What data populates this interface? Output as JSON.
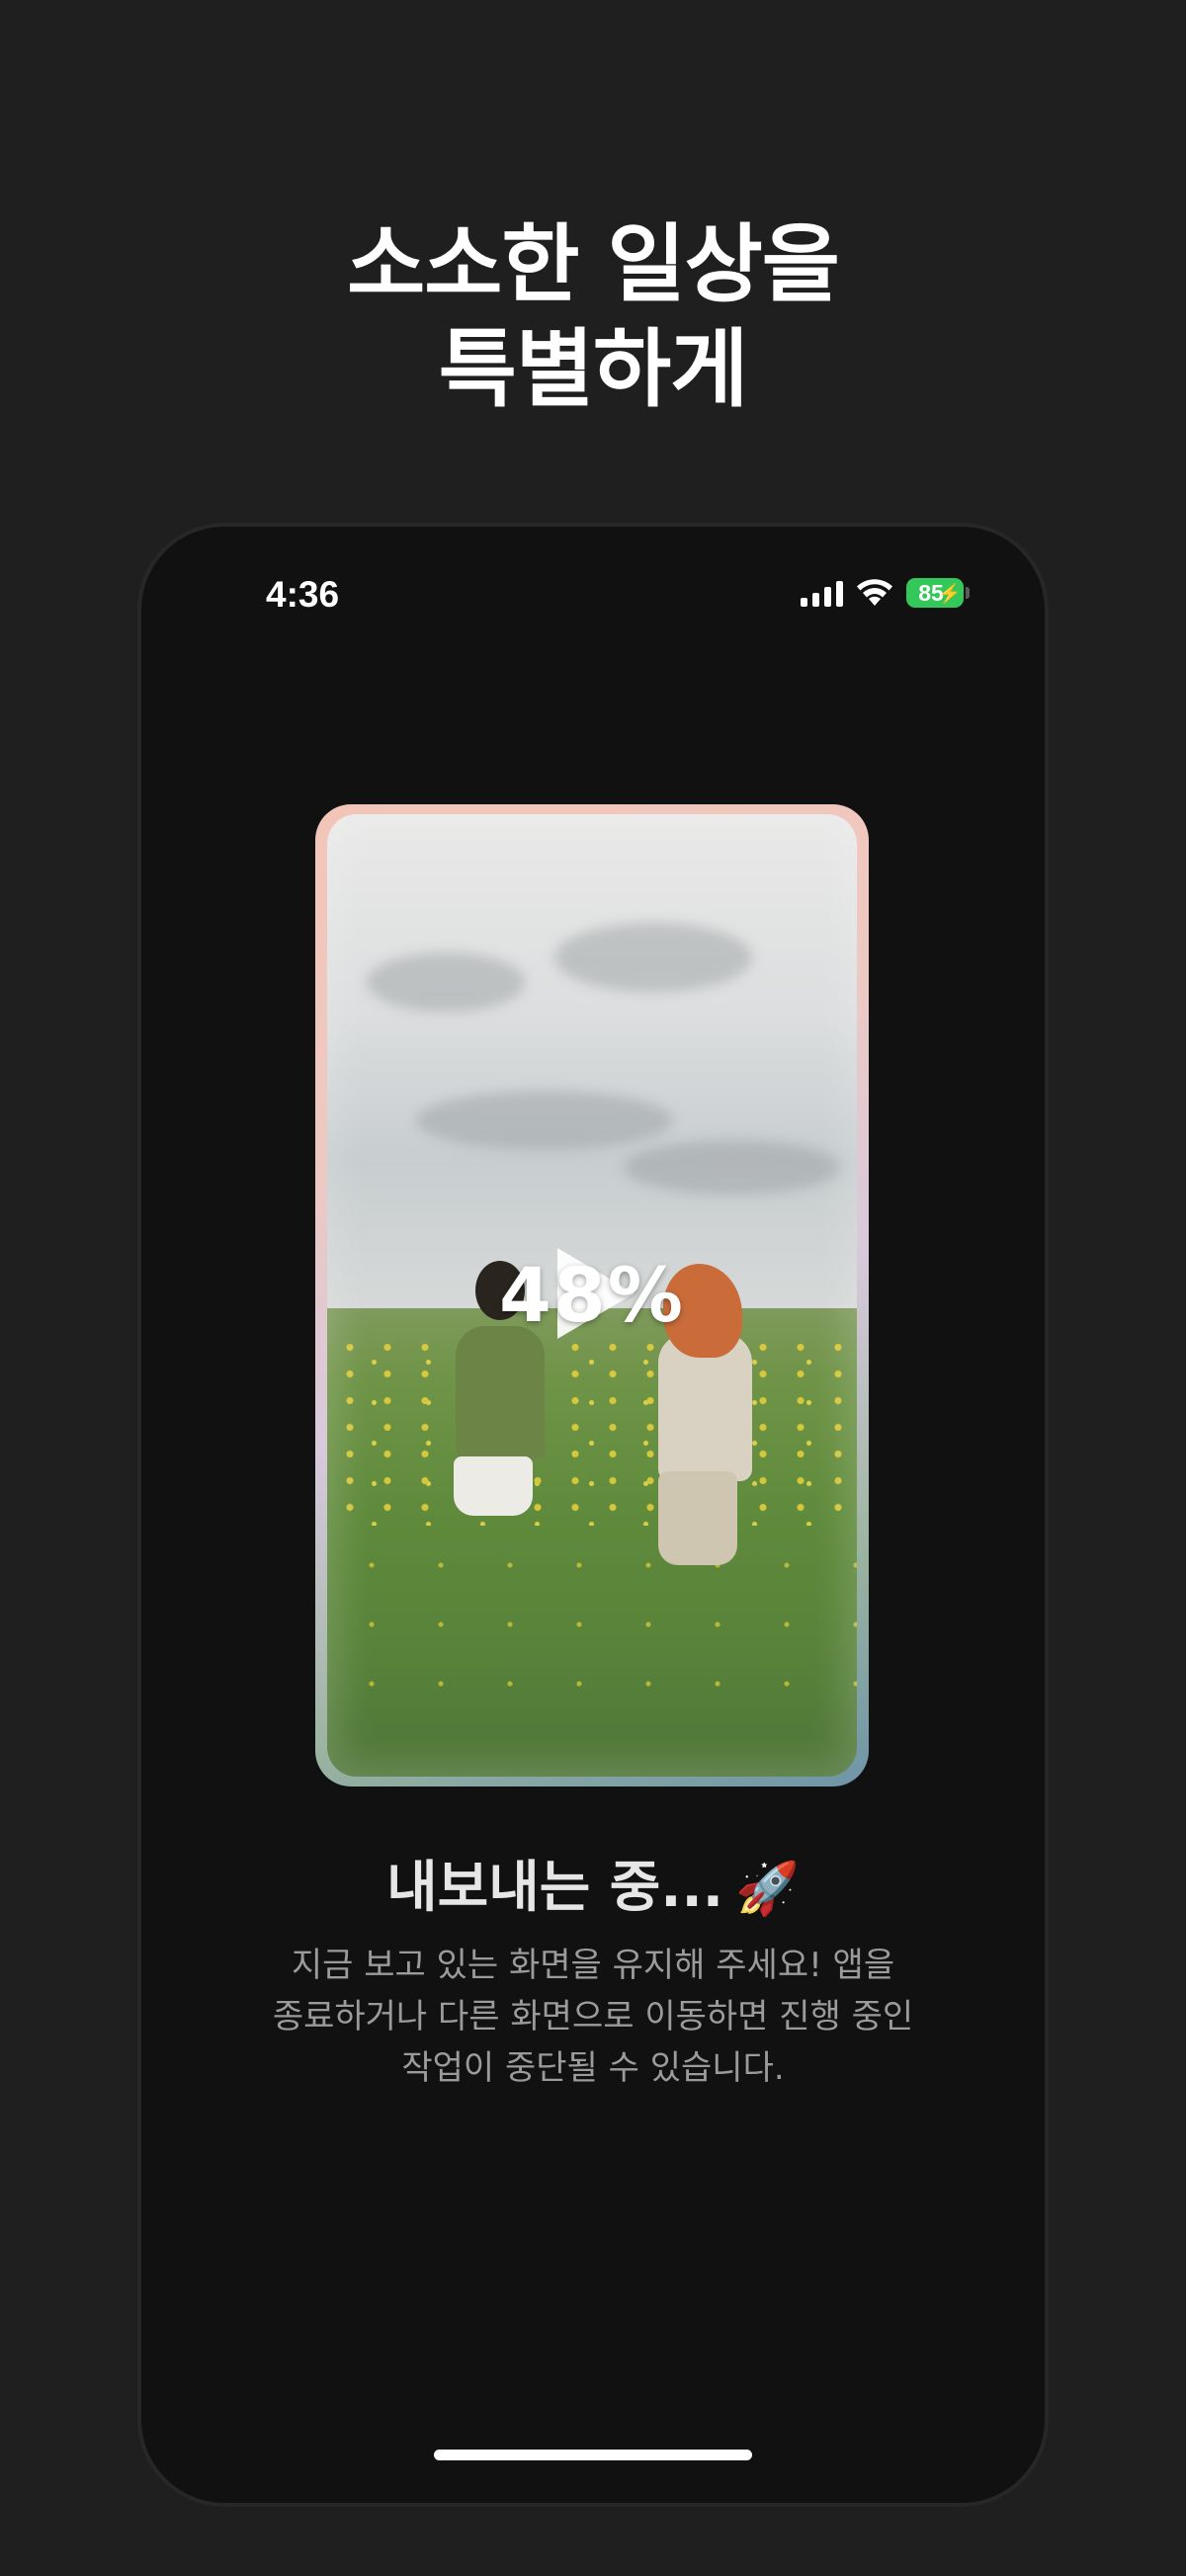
{
  "headline": {
    "line1": "소소한 일상을",
    "line2": "특별하게"
  },
  "status_bar": {
    "time": "4:36",
    "battery_level": "85",
    "battery_color": "#34c759"
  },
  "preview": {
    "progress_text": "48%",
    "progress_value": 48
  },
  "export": {
    "title": "내보내는 중...",
    "emoji": "🚀",
    "description_line1": "지금 보고 있는 화면을 유지해 주세요! 앱을",
    "description_line2": "종료하거나 다른 화면으로 이동하면 진행 중인",
    "description_line3": "작업이 중단될 수 있습니다."
  },
  "icons": {
    "signal": "signal-icon",
    "wifi": "wifi-icon",
    "battery": "battery-icon",
    "play": "play-icon"
  }
}
